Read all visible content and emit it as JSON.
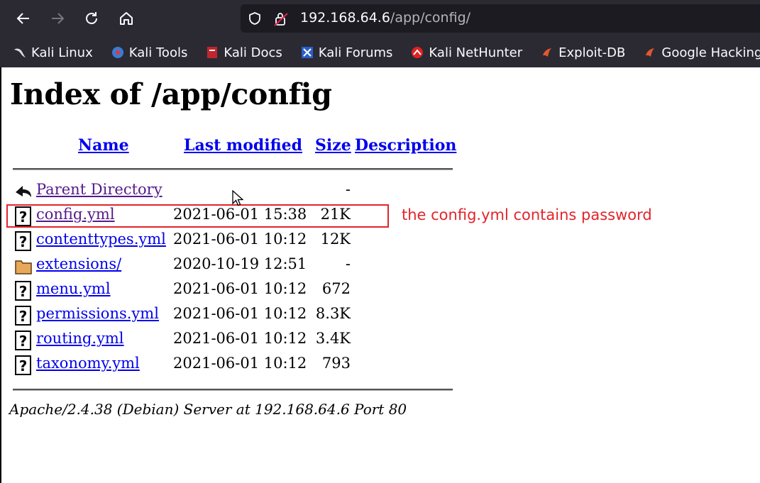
{
  "browser": {
    "url_host": "192.168.64.6",
    "url_path": "/app/config/",
    "bookmarks": [
      {
        "label": "Kali Linux",
        "icon": "kali-dragon-icon"
      },
      {
        "label": "Kali Tools",
        "icon": "kali-tools-icon"
      },
      {
        "label": "Kali Docs",
        "icon": "kali-docs-icon"
      },
      {
        "label": "Kali Forums",
        "icon": "kali-forums-icon"
      },
      {
        "label": "Kali NetHunter",
        "icon": "kali-nethunter-icon"
      },
      {
        "label": "Exploit-DB",
        "icon": "exploit-db-icon"
      },
      {
        "label": "Google Hacking DB",
        "icon": "google-hacking-db-icon"
      }
    ]
  },
  "page": {
    "title": "Index of /app/config",
    "headers": {
      "name": "Name",
      "last_modified": "Last modified",
      "size": "Size",
      "description": "Description"
    },
    "rows": [
      {
        "name": "Parent Directory",
        "date": "",
        "size": "-",
        "icon": "back-arrow-icon"
      },
      {
        "name": "config.yml",
        "date": "2021-06-01 15:38",
        "size": "21K",
        "icon": "unknown-file-icon"
      },
      {
        "name": "contenttypes.yml",
        "date": "2021-06-01 10:12",
        "size": "12K",
        "icon": "unknown-file-icon"
      },
      {
        "name": "extensions/",
        "date": "2020-10-19 12:51",
        "size": "-",
        "icon": "folder-icon"
      },
      {
        "name": "menu.yml",
        "date": "2021-06-01 10:12",
        "size": "672",
        "icon": "unknown-file-icon"
      },
      {
        "name": "permissions.yml",
        "date": "2021-06-01 10:12",
        "size": "8.3K",
        "icon": "unknown-file-icon"
      },
      {
        "name": "routing.yml",
        "date": "2021-06-01 10:12",
        "size": "3.4K",
        "icon": "unknown-file-icon"
      },
      {
        "name": "taxonomy.yml",
        "date": "2021-06-01 10:12",
        "size": "793",
        "icon": "unknown-file-icon"
      }
    ],
    "address": "Apache/2.4.38 (Debian) Server at 192.168.64.6 Port 80",
    "annotation": "the config.yml contains password"
  },
  "colors": {
    "chrome_bg": "#2b2a33",
    "link": "#0000ee",
    "visited": "#551a8b",
    "annotation": "#e3242b"
  }
}
